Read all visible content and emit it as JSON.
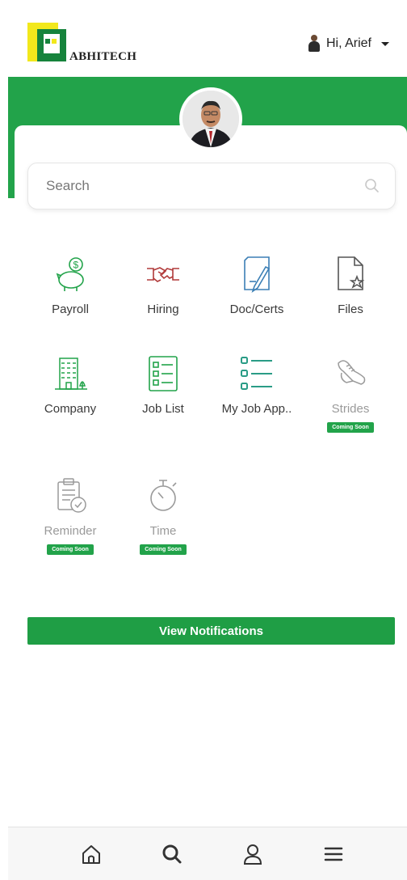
{
  "header": {
    "brand": "ABHITECH",
    "greeting": "Hi, Arief"
  },
  "search": {
    "placeholder": "Search"
  },
  "tiles": [
    {
      "label": "Payroll",
      "icon": "piggy-bank-icon",
      "coming_soon": false
    },
    {
      "label": "Hiring",
      "icon": "handshake-icon",
      "coming_soon": false
    },
    {
      "label": "Doc/Certs",
      "icon": "document-pen-icon",
      "coming_soon": false
    },
    {
      "label": "Files",
      "icon": "file-star-icon",
      "coming_soon": false
    },
    {
      "label": "Company",
      "icon": "building-icon",
      "coming_soon": false
    },
    {
      "label": "Job List",
      "icon": "list-icon",
      "coming_soon": false
    },
    {
      "label": "My Job App..",
      "icon": "checklist-icon",
      "coming_soon": false
    },
    {
      "label": "Strides",
      "icon": "shoe-icon",
      "coming_soon": true
    },
    {
      "label": "Reminder",
      "icon": "clipboard-check-icon",
      "coming_soon": true
    },
    {
      "label": "Time",
      "icon": "stopwatch-icon",
      "coming_soon": true
    }
  ],
  "badge_text": "Coming Soon",
  "notifications_button": "View Notifications",
  "bottom_nav": [
    "home-icon",
    "search-icon",
    "profile-icon",
    "menu-icon"
  ],
  "colors": {
    "primary_green": "#22a34a",
    "badge_green": "#22a34a",
    "logo_yellow": "#f2e81c",
    "logo_green": "#16833c",
    "hiring_red": "#b13a3a",
    "doc_blue": "#3b7fb5"
  }
}
